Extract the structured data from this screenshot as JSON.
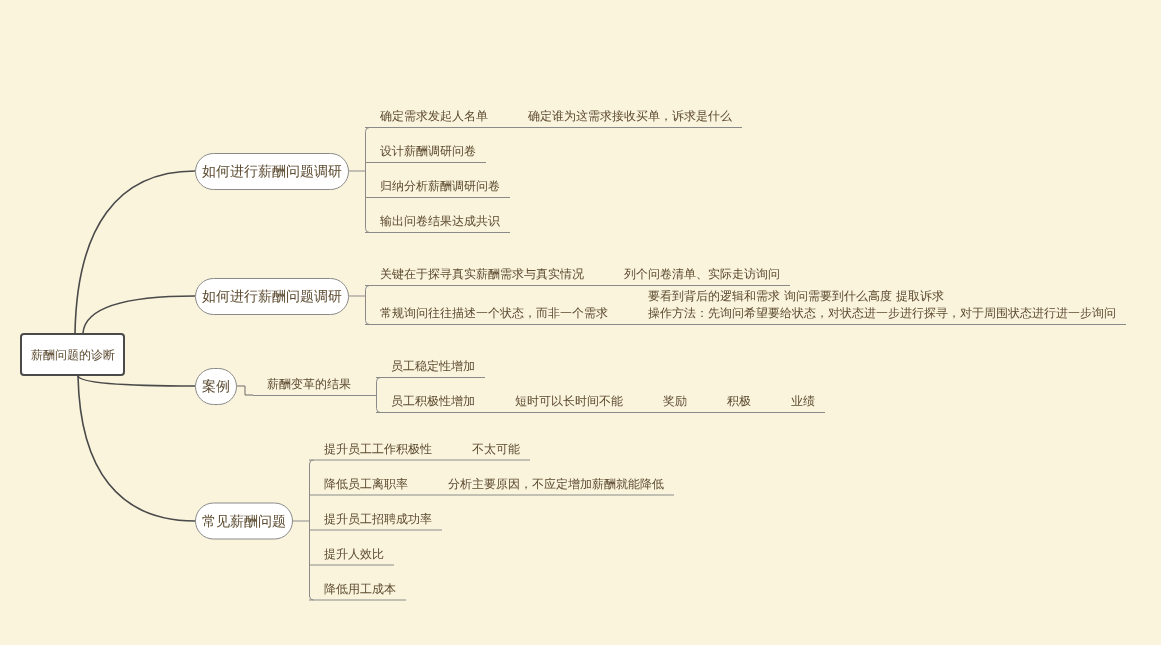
{
  "central_topic": {
    "label": "薪酬问题的诊断",
    "children": [
      {
        "label": "如何进行薪酬问题调研",
        "children": [
          {
            "label": "确定需求发起人名单",
            "children": [
              {
                "label": "确定谁为这需求接收买单，诉求是什么"
              }
            ]
          },
          {
            "label": "设计薪酬调研问卷"
          },
          {
            "label": "归纳分析薪酬调研问卷"
          },
          {
            "label": "输出问卷结果达成共识"
          }
        ]
      },
      {
        "label": "如何进行薪酬问题调研",
        "children": [
          {
            "label": "关键在于探寻真实薪酬需求与真实情况",
            "children": [
              {
                "label": "列个问卷清单、实际走访询问"
              }
            ]
          },
          {
            "label": "常规询问往往描述一个状态，而非一个需求",
            "children": [
              {
                "lines": [
                  "要看到背后的逻辑和需求 询问需要到什么高度 提取诉求",
                  "操作方法：先询问希望要给状态，对状态进一步进行探寻，对于周围状态进行进一步询问"
                ]
              }
            ]
          }
        ]
      },
      {
        "label": "案例",
        "children": [
          {
            "label": "薪酬变革的结果",
            "children": [
              {
                "label": "员工稳定性增加"
              },
              {
                "label": "员工积极性增加",
                "children": [
                  {
                    "label": "短时可以长时间不能",
                    "children": [
                      {
                        "label": "奖励",
                        "children": [
                          {
                            "label": "积极",
                            "children": [
                              {
                                "label": "业绩"
                              }
                            ]
                          }
                        ]
                      }
                    ]
                  }
                ]
              }
            ]
          }
        ]
      },
      {
        "label": "常见薪酬问题",
        "children": [
          {
            "label": "提升员工工作积极性",
            "children": [
              {
                "label": "不太可能"
              }
            ]
          },
          {
            "label": "降低员工离职率",
            "children": [
              {
                "label": "分析主要原因，不应定增加薪酬就能降低"
              }
            ]
          },
          {
            "label": "提升员工招聘成功率"
          },
          {
            "label": "提升人效比"
          },
          {
            "label": "降低用工成本"
          }
        ]
      }
    ]
  }
}
